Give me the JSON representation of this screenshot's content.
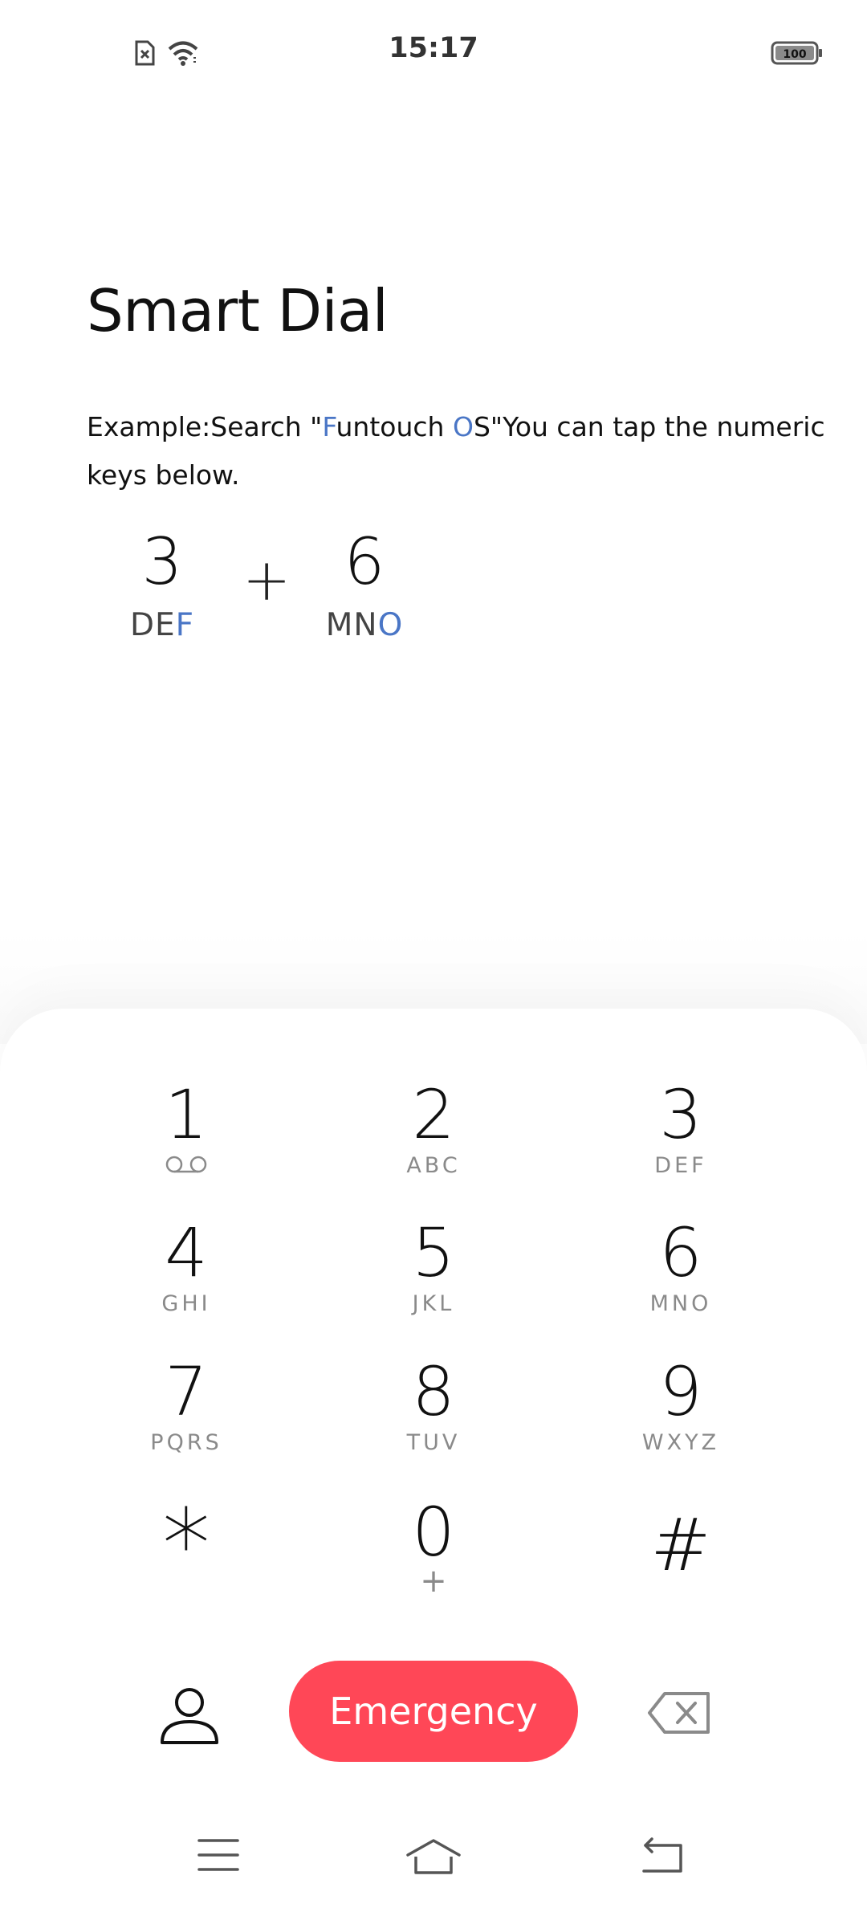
{
  "status_bar": {
    "time": "15:17",
    "battery_level": "100",
    "icons": [
      "sim-off-icon",
      "wifi-icon",
      "battery-icon"
    ]
  },
  "smart_dial": {
    "title": "Smart Dial",
    "hint_prefix": "Example:Search \"",
    "hint_highlight1": "F",
    "hint_mid": "untouch ",
    "hint_highlight2": "O",
    "hint_suffix": "S\"You can tap the numeric keys below.",
    "example": {
      "key1": {
        "digit": "3",
        "letters_plain": "DE",
        "letters_highlight": "F"
      },
      "plus": "+",
      "key2": {
        "digit": "6",
        "letters_plain": "MN",
        "letters_highlight": "O"
      }
    }
  },
  "dialpad": {
    "keys": [
      {
        "digit": "1",
        "letters": "",
        "icon": "voicemail-icon"
      },
      {
        "digit": "2",
        "letters": "ABC"
      },
      {
        "digit": "3",
        "letters": "DEF"
      },
      {
        "digit": "4",
        "letters": "GHI"
      },
      {
        "digit": "5",
        "letters": "JKL"
      },
      {
        "digit": "6",
        "letters": "MNO"
      },
      {
        "digit": "7",
        "letters": "PQRS"
      },
      {
        "digit": "8",
        "letters": "TUV"
      },
      {
        "digit": "9",
        "letters": "WXYZ"
      },
      {
        "digit": "*",
        "letters": ""
      },
      {
        "digit": "0",
        "letters": "+"
      },
      {
        "digit": "#",
        "letters": ""
      }
    ]
  },
  "actions": {
    "emergency_label": "Emergency",
    "contacts_icon": "person-icon",
    "backspace_icon": "backspace-icon"
  },
  "colors": {
    "accent_blue": "#4a76c6",
    "emergency_red": "#ff4757",
    "secondary_text": "#8a8a8a"
  },
  "nav_bar": {
    "icons": [
      "menu-icon",
      "home-icon",
      "back-icon"
    ]
  }
}
